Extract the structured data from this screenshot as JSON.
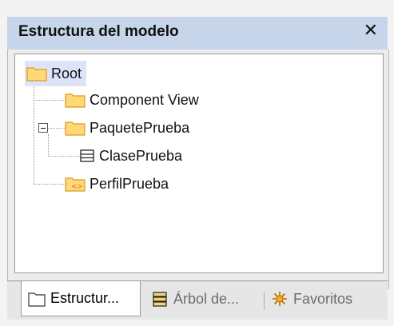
{
  "panel": {
    "title": "Estructura del modelo",
    "close_glyph": "✕"
  },
  "tree": {
    "root": "Root",
    "component_view": "Component View",
    "paquete": "PaquetePrueba",
    "clase": "ClasePrueba",
    "perfil": "PerfilPrueba"
  },
  "tabs": {
    "estructura": "Estructur...",
    "arbol": "Árbol de...",
    "favoritos": "Favoritos"
  },
  "icons": {
    "folder": "folder-icon",
    "class": "class-icon",
    "profile": "profile-folder-icon",
    "tree_tab": "tree-diagram-icon",
    "favorites": "favorites-icon"
  },
  "colors": {
    "titlebar": "#c6d5ea",
    "selection": "#dde4fa",
    "folder_fill": "#ffd877",
    "folder_stroke": "#d99a1f"
  }
}
